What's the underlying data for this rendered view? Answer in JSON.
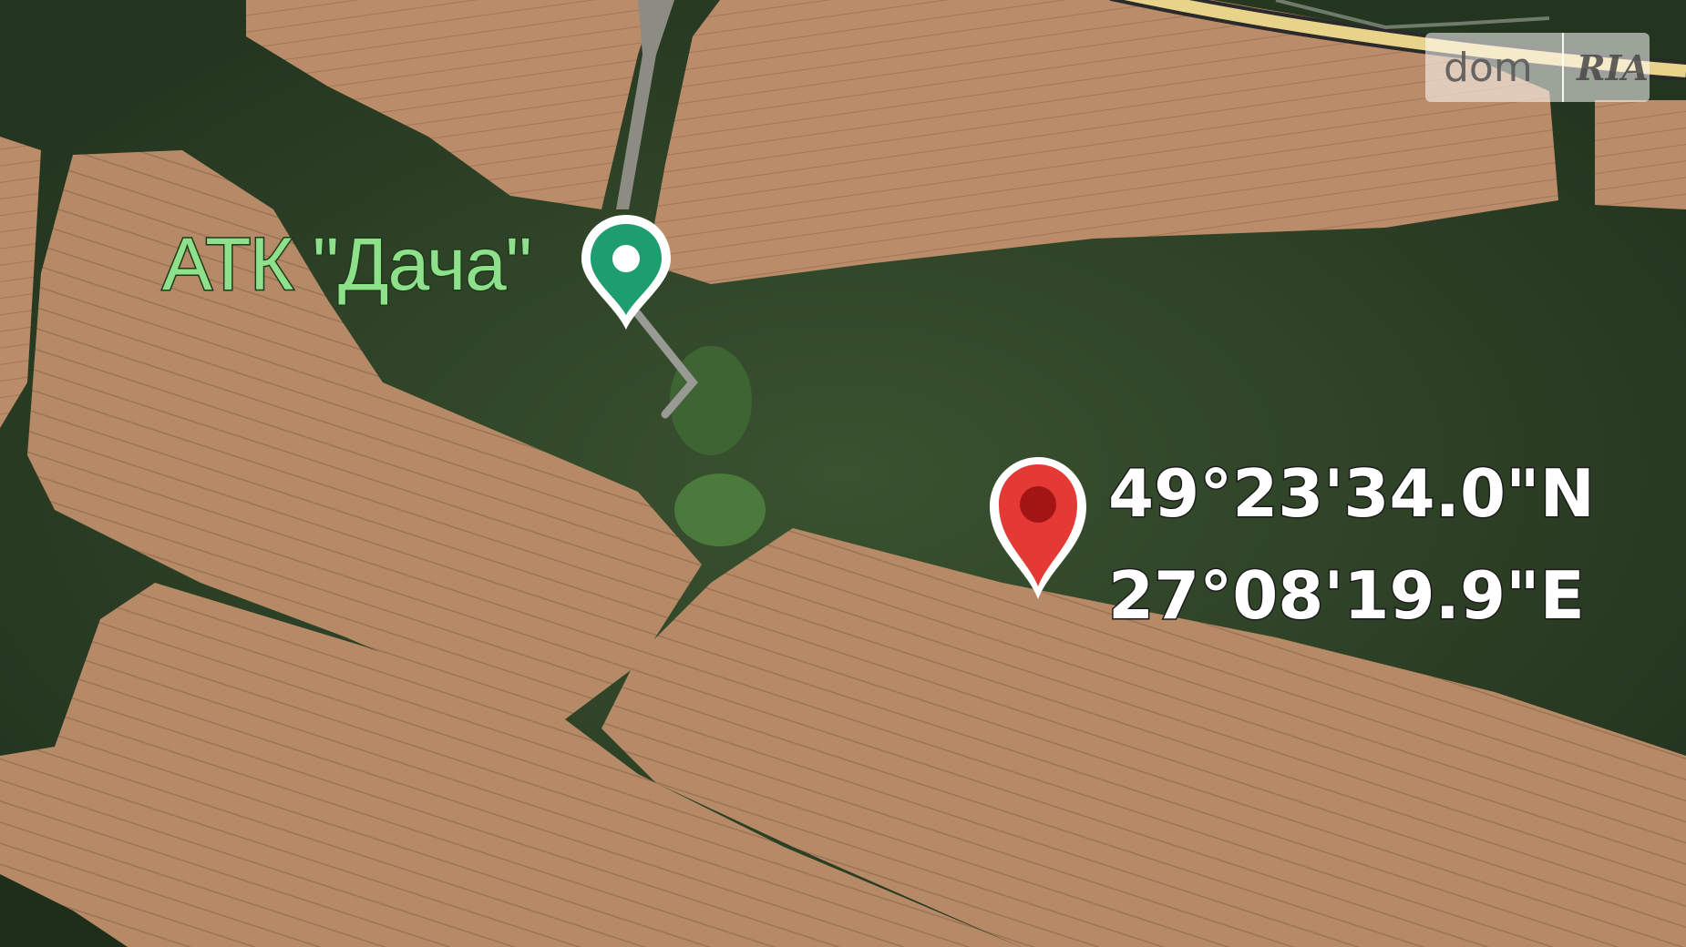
{
  "map": {
    "type": "satellite",
    "poi": {
      "label": "АТК \"Дача\"",
      "pin_color": "#1e9e6e",
      "icon": "place-pin-icon"
    },
    "dropped_pin": {
      "latitude": "49°23'34.0\"N",
      "longitude": "27°08'19.9\"E",
      "pin_color": "#e53935",
      "icon": "location-pin-icon"
    }
  },
  "watermark": {
    "brand_left": "dom",
    "brand_right": "RIA"
  },
  "colors": {
    "forest": "#2d4226",
    "field": "#b68a66",
    "road": "#e8d38a"
  }
}
